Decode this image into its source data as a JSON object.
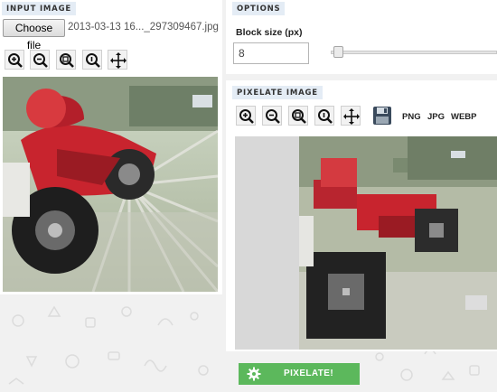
{
  "input_panel": {
    "title": "INPUT IMAGE",
    "choose_file_label": "Choose file",
    "file_name": "2013-03-13 16..._297309467.jpg",
    "tools": [
      "zoom-in-icon",
      "zoom-out-icon",
      "zoom-fit-icon",
      "zoom-reset-icon",
      "move-icon"
    ]
  },
  "options_panel": {
    "title": "OPTIONS",
    "block_size_label": "Block size (px)",
    "block_size_value": "8",
    "slider_value_fraction": 0.02
  },
  "output_panel": {
    "title": "PIXELATE IMAGE",
    "tools": [
      "zoom-in-icon",
      "zoom-out-icon",
      "zoom-fit-icon",
      "zoom-reset-icon",
      "move-icon",
      "save-icon"
    ],
    "formats": [
      "PNG",
      "JPG",
      "WEBP"
    ]
  },
  "action": {
    "button_label": "PIXELATE!",
    "button_icon": "gear-icon",
    "color": "#5cb85c"
  }
}
